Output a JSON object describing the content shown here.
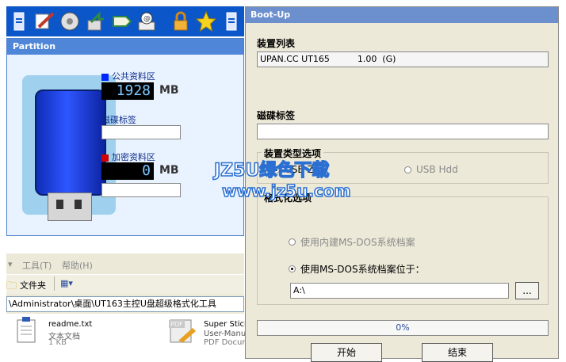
{
  "partition": {
    "title": "Partition",
    "public_area_label": "公共资料区",
    "public_size": "1928",
    "public_unit": "MB",
    "disk_label_label": "磁碟标签",
    "disk_label_value": "",
    "encrypted_area_label": "加密资料区",
    "encrypted_size": "0",
    "encrypted_unit": "MB"
  },
  "toolbar_icons": [
    "drive-icon",
    "pen-icon",
    "disk-icon",
    "arrow-icon",
    "tag-icon",
    "email-icon",
    "lock-icon",
    "star-icon",
    "drive-icon"
  ],
  "explorer": {
    "menu": [
      "工具(T)",
      "帮助(H)"
    ],
    "folders_label": "文件夹",
    "address": "\\Administrator\\桌面\\UT163主控U盘超级格式化工具",
    "files": [
      {
        "name": "readme.txt",
        "type": "文本文档",
        "size": "1 KB"
      },
      {
        "name": "Super Stick",
        "type": "User-Manual",
        "size": "PDF Document"
      }
    ]
  },
  "bootup": {
    "title": "Boot-Up",
    "device_list_label": "装置列表",
    "device_entry": "UPAN.CC UT165          1.00  (G)",
    "disk_label_label": "磁碟标签",
    "disk_label_value": "",
    "device_type_label": "装置类型选项",
    "usb_zip_label": "USB Zip",
    "usb_hdd_label": "USB Hdd",
    "format_options_label": "格式化选项",
    "builtin_dos_label": "使用内建MS-DOS系统档案",
    "dos_location_label": "使用MS-DOS系统档案位于：",
    "path_value": "A:\\",
    "browse_label": "...",
    "progress_percent": 0,
    "progress_text": "0%",
    "start_label": "开始",
    "close_label": "结束"
  },
  "watermark": {
    "line1": "JZ5U绿色下载",
    "line2": "www.jz5u.com"
  }
}
